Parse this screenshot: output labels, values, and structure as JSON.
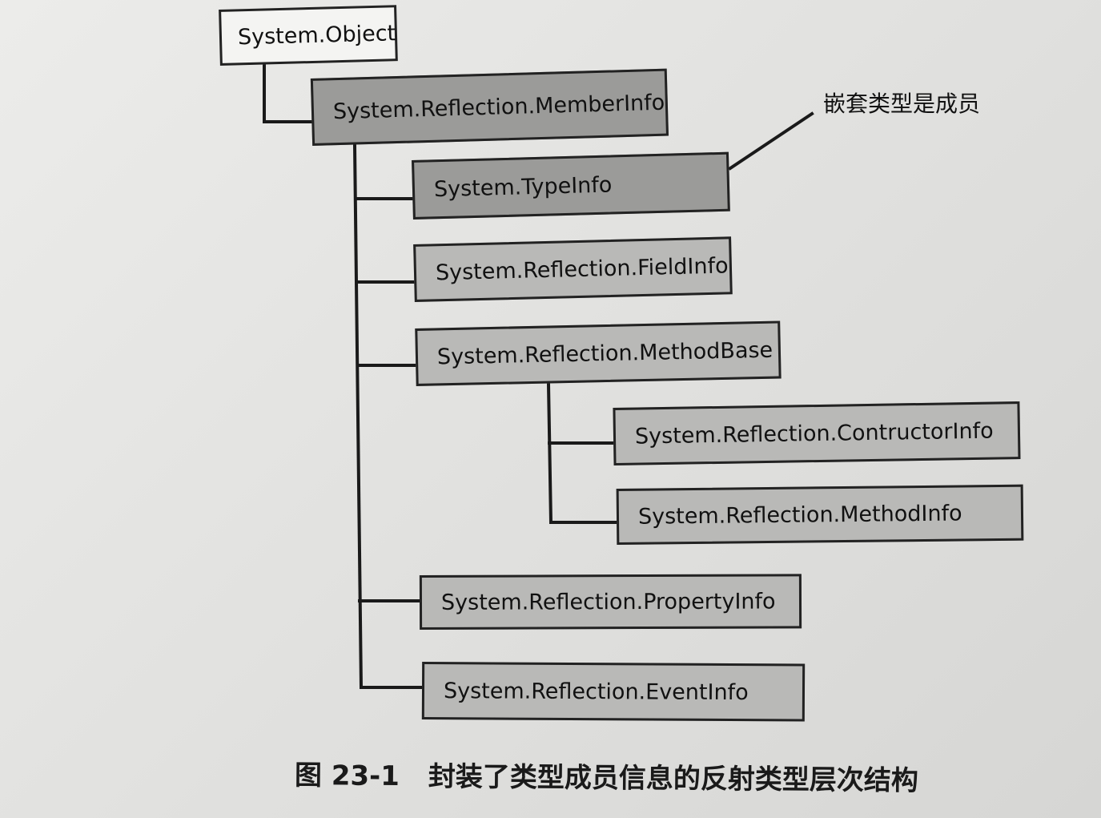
{
  "diagram": {
    "nodes": {
      "object": "System.Object",
      "member_info": "System.Reflection.MemberInfo",
      "type_info": "System.TypeInfo",
      "field_info": "System.Reflection.FieldInfo",
      "method_base": "System.Reflection.MethodBase",
      "constructor_info": "System.Reflection.ContructorInfo",
      "method_info": "System.Reflection.MethodInfo",
      "property_info": "System.Reflection.PropertyInfo",
      "event_info": "System.Reflection.EventInfo"
    },
    "annotation": "嵌套类型是成员",
    "caption": {
      "number": "图 23-1",
      "text": "封装了类型成员信息的反射类型层次结构"
    }
  }
}
